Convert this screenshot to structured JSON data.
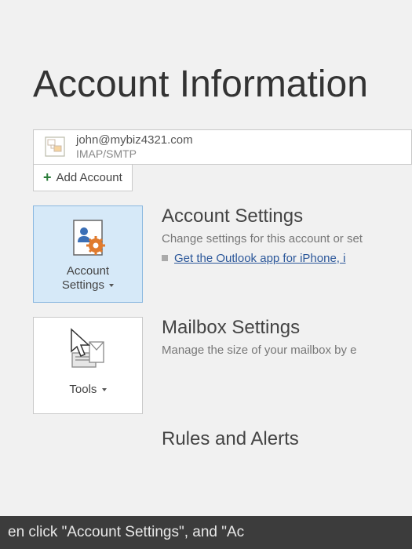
{
  "header": {
    "title": "Account Information"
  },
  "account": {
    "email": "john@mybiz4321.com",
    "protocol": "IMAP/SMTP"
  },
  "add_account": {
    "label": "Add Account"
  },
  "account_settings": {
    "button_label_line1": "Account",
    "button_label_line2": "Settings",
    "title": "Account Settings",
    "description": "Change settings for this account or set",
    "link": "Get the Outlook app for iPhone, i"
  },
  "mailbox_settings": {
    "button_label": "Tools",
    "title": "Mailbox Settings",
    "description": "Manage the size of your mailbox by e"
  },
  "rules": {
    "title": "Rules and Alerts"
  },
  "caption": {
    "text": "en click \"Account Settings\", and \"Ac"
  }
}
